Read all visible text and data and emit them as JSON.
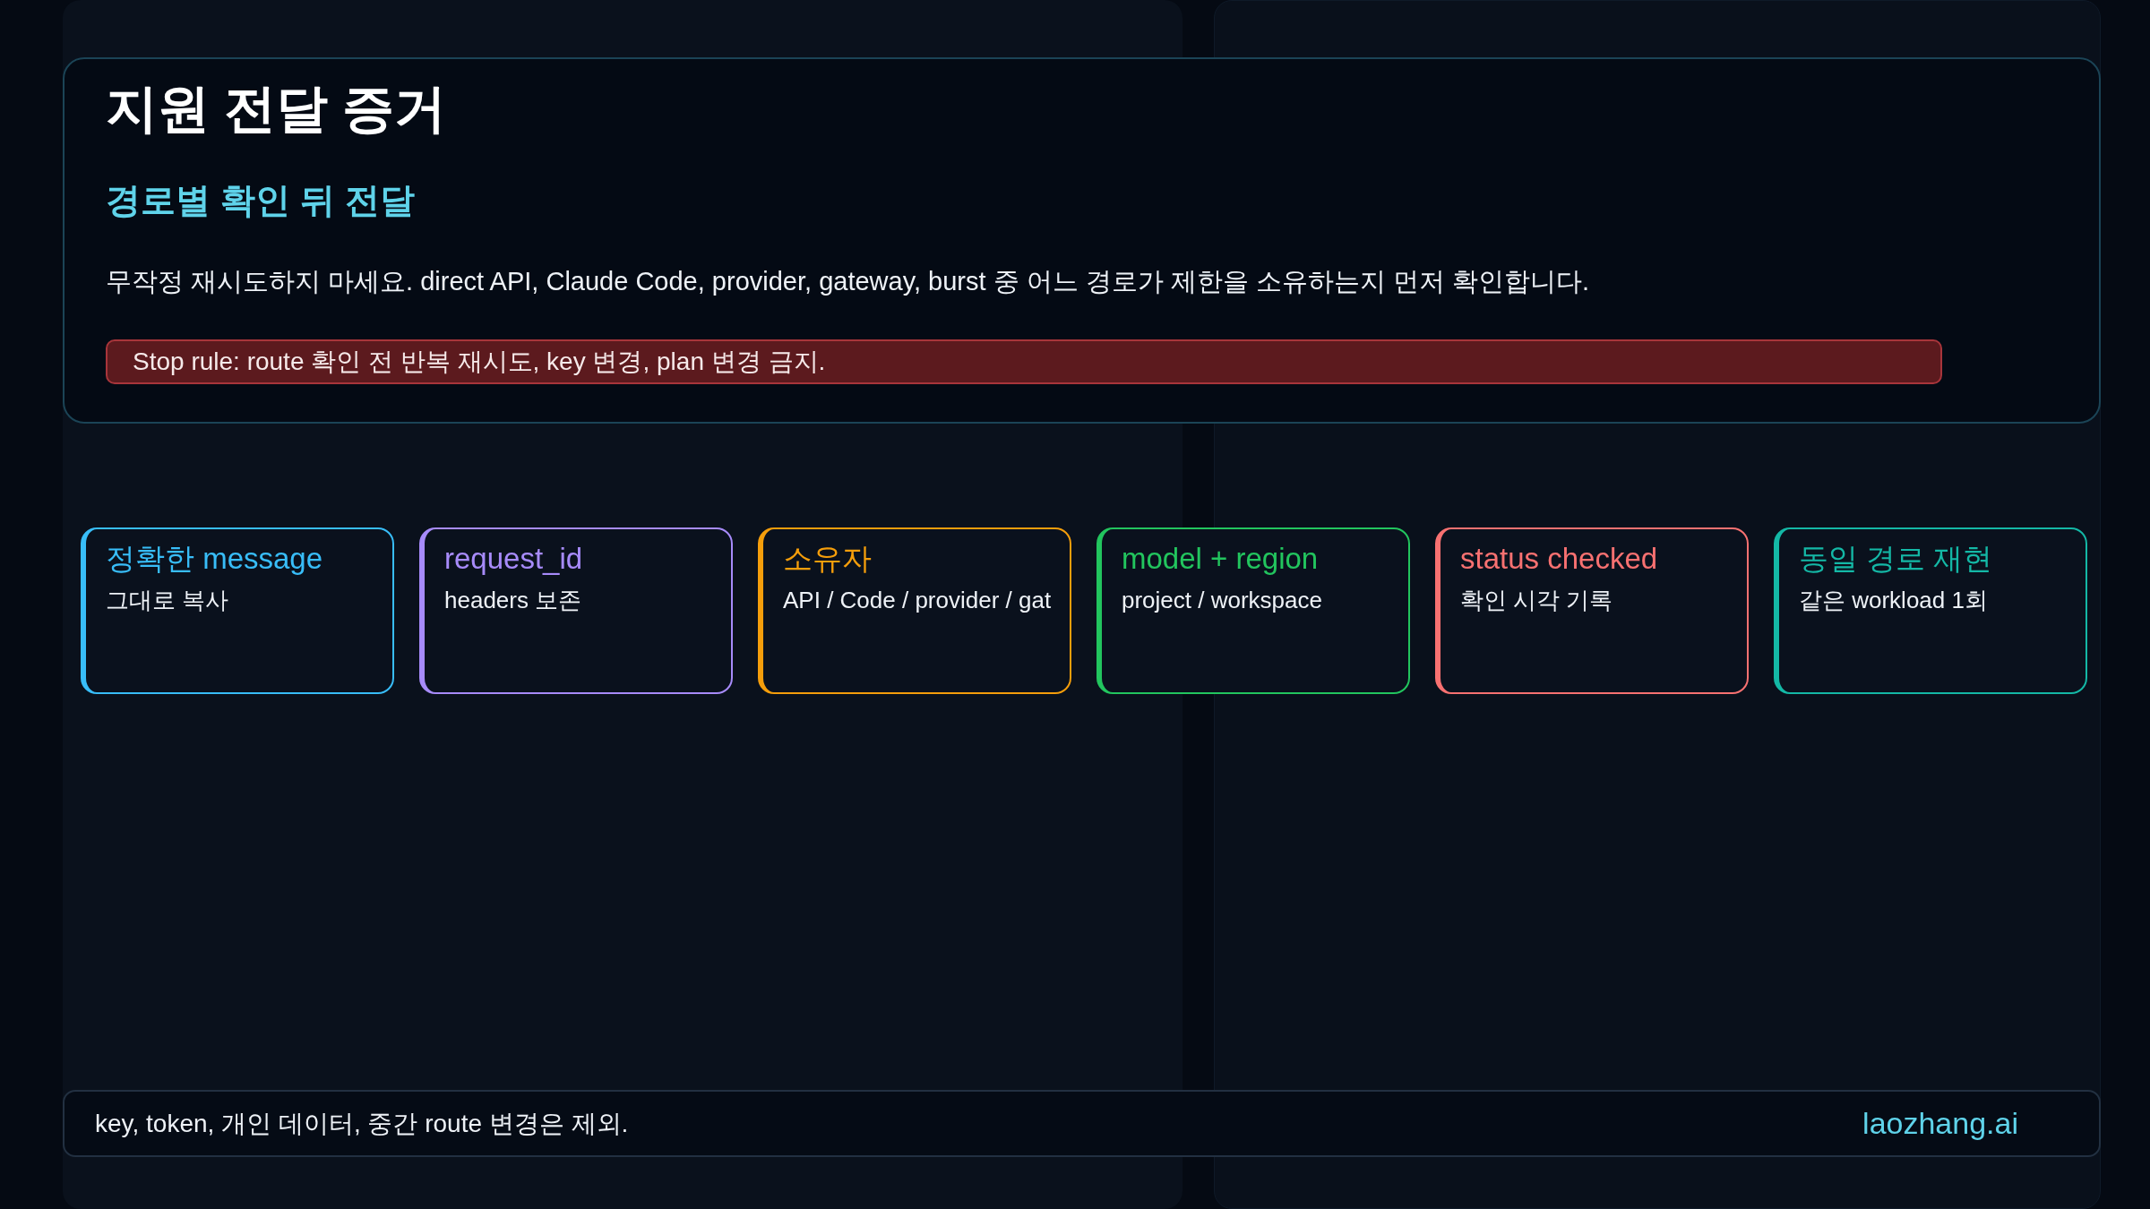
{
  "overlay": {
    "title": "지원 전달 증거",
    "subtitle": "경로별 확인 뒤 전달",
    "description": "무작정 재시도하지 마세요. direct API, Claude Code, provider, gateway, burst 중 어느 경로가 제한을 소유하는지 먼저 확인합니다.",
    "stop_rule": "Stop rule: route 확인 전 반복 재시도, key 변경, plan 변경 금지."
  },
  "cards": [
    {
      "title": "정확한 message",
      "text": "그대로 복사",
      "color": "#38bdf8"
    },
    {
      "title": "request_id",
      "text": "headers 보존",
      "color": "#a78bfa"
    },
    {
      "title": "소유자",
      "text": "API / Code / provider / gat",
      "color": "#f59e0b"
    },
    {
      "title": "model + region",
      "text": "project / workspace",
      "color": "#22c55e"
    },
    {
      "title": "status checked",
      "text": "확인 시각 기록",
      "color": "#f87171"
    },
    {
      "title": "동일 경로 재현",
      "text": "같은 workload 1회",
      "color": "#14b8a6"
    }
  ],
  "footer": {
    "note": "key, token, 개인 데이터, 중간 route 변경은 제외.",
    "brand": "laozhang.ai"
  }
}
